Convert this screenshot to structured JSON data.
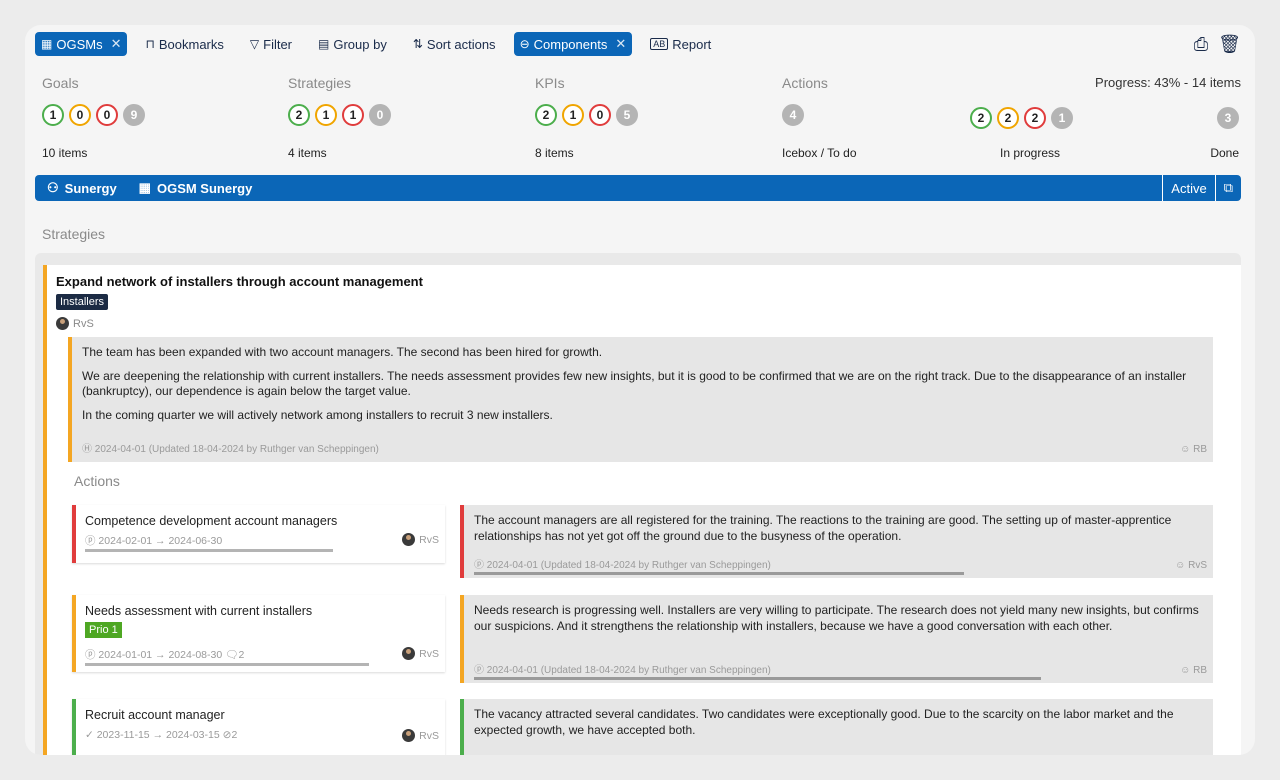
{
  "toolbar": {
    "ogsms": "OGSMs",
    "bookmarks": "Bookmarks",
    "filter": "Filter",
    "group_by": "Group by",
    "sort_actions": "Sort actions",
    "components": "Components",
    "report": "Report"
  },
  "stats": {
    "goals": {
      "label": "Goals",
      "values": [
        "1",
        "0",
        "0",
        "9"
      ],
      "count": "10 items"
    },
    "strategies": {
      "label": "Strategies",
      "values": [
        "2",
        "1",
        "1",
        "0"
      ],
      "count": "4 items"
    },
    "kpis": {
      "label": "KPIs",
      "values": [
        "2",
        "1",
        "0",
        "5"
      ],
      "count": "8 items"
    },
    "actions": {
      "label": "Actions",
      "progress": "Progress: 43% - 14 items",
      "icebox": {
        "value": "4",
        "label": "Icebox / To do"
      },
      "in_progress": {
        "values": [
          "2",
          "2",
          "2",
          "1"
        ],
        "label": "In progress"
      },
      "done": {
        "value": "3",
        "label": "Done"
      }
    }
  },
  "context": {
    "org": "Sunergy",
    "ogsm": "OGSM Sunergy",
    "status": "Active"
  },
  "section_strategies": "Strategies",
  "strategy": {
    "title": "Expand network of installers through account management",
    "tag": "Installers",
    "owner": "RvS",
    "note": {
      "p1": "The team has been expanded with two account managers. The second has been hired for growth.",
      "p2": "We are deepening the relationship with current installers. The needs assessment provides few new insights, but it is good to be confirmed that we are on the right track. Due to the disappearance of an installer (bankruptcy), our dependence is again below the target value.",
      "p3": "In the coming quarter we will actively network among installers to recruit 3 new installers.",
      "meta": "2024-04-01 (Updated 18-04-2024 by Ruthger van Scheppingen)",
      "who": "RB"
    }
  },
  "actions_title": "Actions",
  "actions": [
    {
      "title": "Competence development account managers",
      "dates": "2024-02-01 → 2024-06-30",
      "owner": "RvS",
      "note": "The account managers are all registered for the training. The reactions to the training are good. The setting up of master-apprentice relationships has not yet got off the ground due to the busyness of the operation.",
      "meta": "2024-04-01 (Updated 18-04-2024 by Ruthger van Scheppingen)",
      "who": "RvS",
      "progress": 0.7
    },
    {
      "title": "Needs assessment with current installers",
      "tag": "Prio 1",
      "dates": "2024-01-01 → 2024-08-30",
      "extra": "2",
      "owner": "RvS",
      "note": "Needs research is progressing well. Installers are very willing to participate. The research does not yield many new insights, but confirms our suspicions. And it strengthens the relationship with installers, because we have a good conversation with each other.",
      "meta": "2024-04-01 (Updated 18-04-2024 by Ruthger van Scheppingen)",
      "who": "RB",
      "progress": 0.81
    },
    {
      "title": "Recruit account manager",
      "dates": "2023-11-15 → 2024-03-15",
      "extra": "2",
      "owner": "RvS",
      "note": "The vacancy attracted several candidates. Two candidates were exceptionally good. Due to the scarcity on the labor market and the expected growth, we have accepted both."
    }
  ],
  "colors": {
    "primary": "#0b66b7",
    "green": "#4cae4c",
    "yellow": "#f0a500",
    "red": "#e03c3c",
    "grey": "#b4b4b4",
    "strategy_accent": "#f4a623",
    "prio": "#4ea723"
  }
}
